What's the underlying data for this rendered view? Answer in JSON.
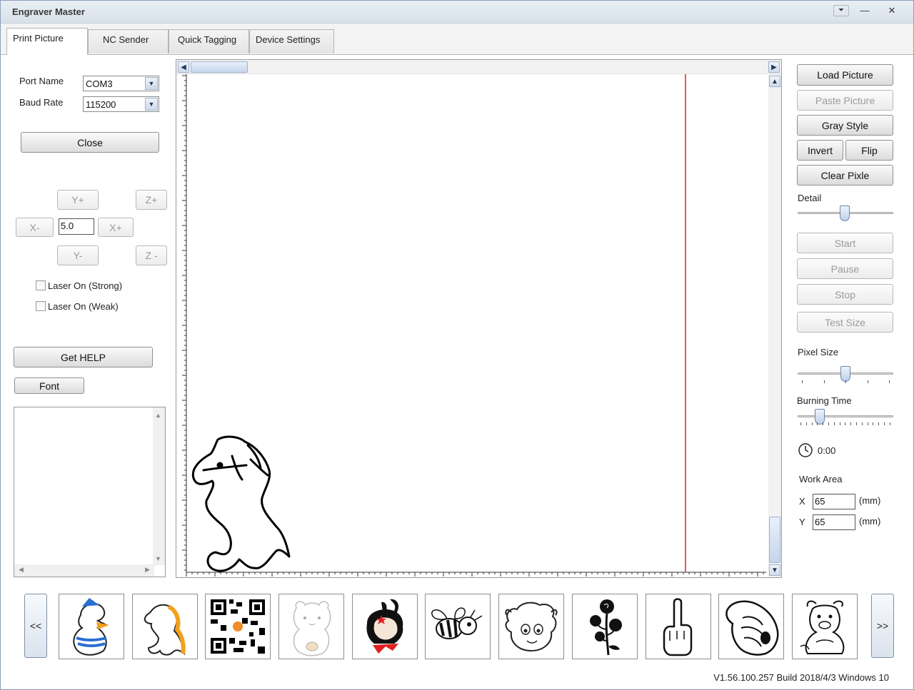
{
  "window": {
    "title": "Engraver Master"
  },
  "titlebar_controls": {
    "restore": "⏷",
    "minimize": "—",
    "close": "✕"
  },
  "tabs": [
    {
      "label": "Print Picture"
    },
    {
      "label": "NC Sender"
    },
    {
      "label": "Quick Tagging"
    },
    {
      "label": "Device Settings"
    }
  ],
  "connection": {
    "port_label": "Port Name",
    "port_value": "COM3",
    "baud_label": "Baud Rate",
    "baud_value": "115200",
    "close_button": "Close"
  },
  "jog": {
    "y_plus": "Y+",
    "z_plus": "Z+",
    "x_minus": "X-",
    "step_value": "5.0",
    "x_plus": "X+",
    "y_minus": "Y-",
    "z_minus": "Z -"
  },
  "laser": {
    "strong_label": "Laser On (Strong)",
    "weak_label": "Laser On (Weak)"
  },
  "help_button": "Get HELP",
  "font_button": "Font",
  "actions": {
    "load_picture": "Load Picture",
    "paste_picture": "Paste Picture",
    "gray_style": "Gray Style",
    "invert": "Invert",
    "flip": "Flip",
    "clear_pixle": "Clear Pixle",
    "detail_label": "Detail",
    "start": "Start",
    "pause": "Pause",
    "stop": "Stop",
    "test_size": "Test Size",
    "pixel_size_label": "Pixel Size",
    "burning_time_label": "Burning Time",
    "timer_value": "0:00"
  },
  "work_area": {
    "label": "Work Area",
    "x_label": "X",
    "x_value": "65",
    "y_label": "Y",
    "y_value": "65",
    "unit": "(mm)"
  },
  "gallery": {
    "prev": "<<",
    "next": ">>",
    "items": [
      "duck",
      "pony",
      "qr-code",
      "bear",
      "bunny-girl",
      "bee",
      "sheep",
      "rose",
      "middle-finger",
      "pointing-hand",
      "bull"
    ]
  },
  "status_text": "V1.56.100.257 Build 2018/4/3 Windows 10",
  "colors": {
    "guide_line": "#e02020",
    "accent": "#4a78a8"
  }
}
